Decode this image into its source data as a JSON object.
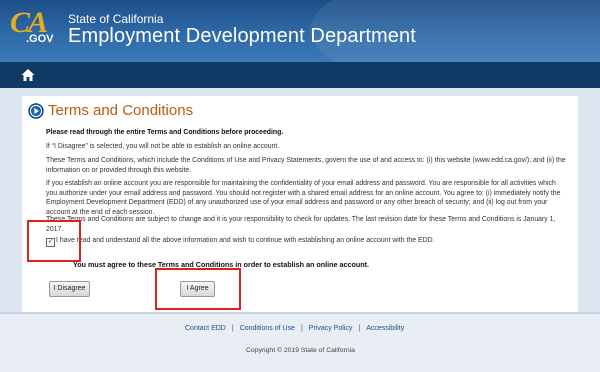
{
  "header": {
    "logo_mark": "CA",
    "logo_suffix": ".GOV",
    "state": "State of California",
    "department": "Employment Development Department",
    "home_icon": "home-icon"
  },
  "page": {
    "title": "Terms and Conditions",
    "intro": "Please read through the entire Terms and Conditions before proceeding.",
    "p1": "If “I Disagree” is selected, you will not be able to establish an online account.",
    "p2": "These Terms and Conditions, which include the Conditions of Use and Privacy Statements, govern the use of and access to: (i) this website (www.edd.ca.gov/); and (ii) the information on or provided through this website.",
    "p3": "If you establish an online account you are responsible for maintaining the confidentiality of your email address and password. You are responsible for all activities which you authorize under your email address and password. You should not register with a shared email address for an online account. You agree to: (i) immediately notify the Employment Development Department (EDD) of any unauthorized use of your email address and password or any other breach of security; and (ii) log out from your account at the end of each session.",
    "p4": "These Terms and Conditions are subject to change and it is your responsibility to check for updates. The last revision date for these Terms and Conditions is January 1, 2017.",
    "checkbox_label": "I have read and understand all the above information and wish to continue with establishing an online account with the EDD.",
    "checkbox_checked": true,
    "must_agree": "You must agree to these Terms and Conditions in order to establish an online account.",
    "disagree_button": "I Disagree",
    "agree_button": "I Agree"
  },
  "footer": {
    "links": [
      "Contact EDD",
      "Conditions of Use",
      "Privacy Policy",
      "Accessibility"
    ],
    "separator": "|",
    "copyright": "Copyright © 2019 State of California"
  },
  "colors": {
    "header_blue": "#2f6aa8",
    "nav_blue": "#0f3a66",
    "title_orange": "#c05a10",
    "highlight_red": "#e02020"
  }
}
